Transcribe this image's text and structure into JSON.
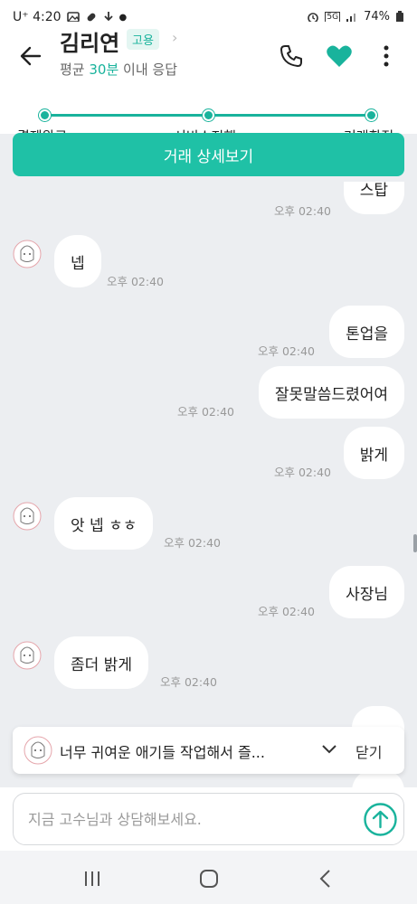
{
  "status_bar": {
    "carrier": "U⁺ 4:20",
    "battery": "74%",
    "network": "5G"
  },
  "header": {
    "name": "김리연",
    "badge": "고용",
    "response_prefix": "평균 ",
    "response_highlight": "30분",
    "response_suffix": " 이내 응답"
  },
  "progress": {
    "steps": [
      "결제완료",
      "서비스진행",
      "거래확정"
    ]
  },
  "deal_button": "거래 상세보기",
  "messages": [
    {
      "side": "right",
      "text": "스탑",
      "time": "오후 02:40"
    },
    {
      "side": "left",
      "text": "넵",
      "time": "오후 02:40"
    },
    {
      "side": "right",
      "text": "톤업을",
      "time": "오후 02:40"
    },
    {
      "side": "right",
      "text": "잘못말씀드렸어여",
      "time": "오후 02:40"
    },
    {
      "side": "right",
      "text": "밝게",
      "time": "오후 02:40"
    },
    {
      "side": "left",
      "text": "앗 넵 ㅎㅎ",
      "time": "오후 02:40"
    },
    {
      "side": "right",
      "text": "사장님",
      "time": "오후 02:40"
    },
    {
      "side": "left",
      "text": "좀더 밝게",
      "time": "오후 02:40"
    }
  ],
  "banner": {
    "message": "너무 귀여운 애기들 작업해서 즐...",
    "close_label": "닫기"
  },
  "input": {
    "placeholder": "지금 고수님과 상담해보세요."
  },
  "colors": {
    "accent": "#1fc1a6",
    "accent_dark": "#19b39c",
    "chat_bg": "#eceef1"
  }
}
